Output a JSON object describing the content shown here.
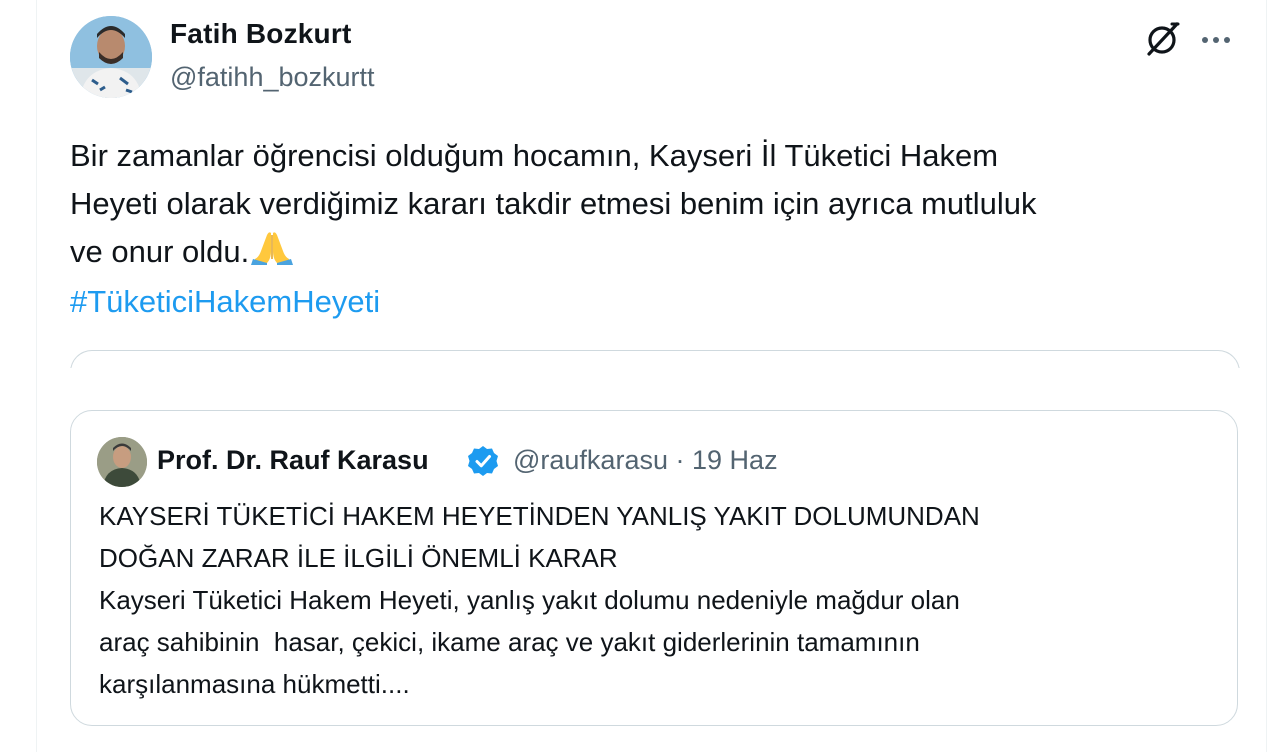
{
  "post": {
    "author": {
      "name": "Fatih Bozkurt",
      "handle": "@fatihh_bozkurtt"
    },
    "text_lines": [
      "Bir zamanlar öğrencisi olduğum hocamın, Kayseri İl Tüketici Hakem",
      "Heyeti olarak verdiğimiz kararı takdir etmesi benim için ayrıca mutluluk",
      "ve onur oldu."
    ],
    "hashtag": "#TüketiciHakemHeyeti",
    "icons": {
      "grok": "grok-icon",
      "more": "more-options-icon",
      "emoji": "folded-hands-emoji"
    }
  },
  "quote": {
    "author": {
      "name": "Prof. Dr. Rauf Karasu",
      "handle": "@raufkarasu",
      "separator": "·",
      "date": "19 Haz",
      "verified": true
    },
    "text_lines": [
      "KAYSERİ TÜKETİCİ HAKEM HEYETİNDEN YANLIŞ YAKIT DOLUMUNDAN",
      "DOĞAN ZARAR İLE İLGİLİ ÖNEMLİ KARAR",
      "Kayseri Tüketici Hakem Heyeti, yanlış yakıt dolumu nedeniyle mağdur olan",
      "araç sahibinin  hasar, çekici, ikame araç ve yakıt giderlerinin tamamının",
      "karşılanmasına hükmetti...."
    ]
  },
  "colors": {
    "link": "#1d9bf0",
    "secondary_text": "#536471",
    "border": "#cfd9de",
    "verified": "#1d9bf0"
  }
}
